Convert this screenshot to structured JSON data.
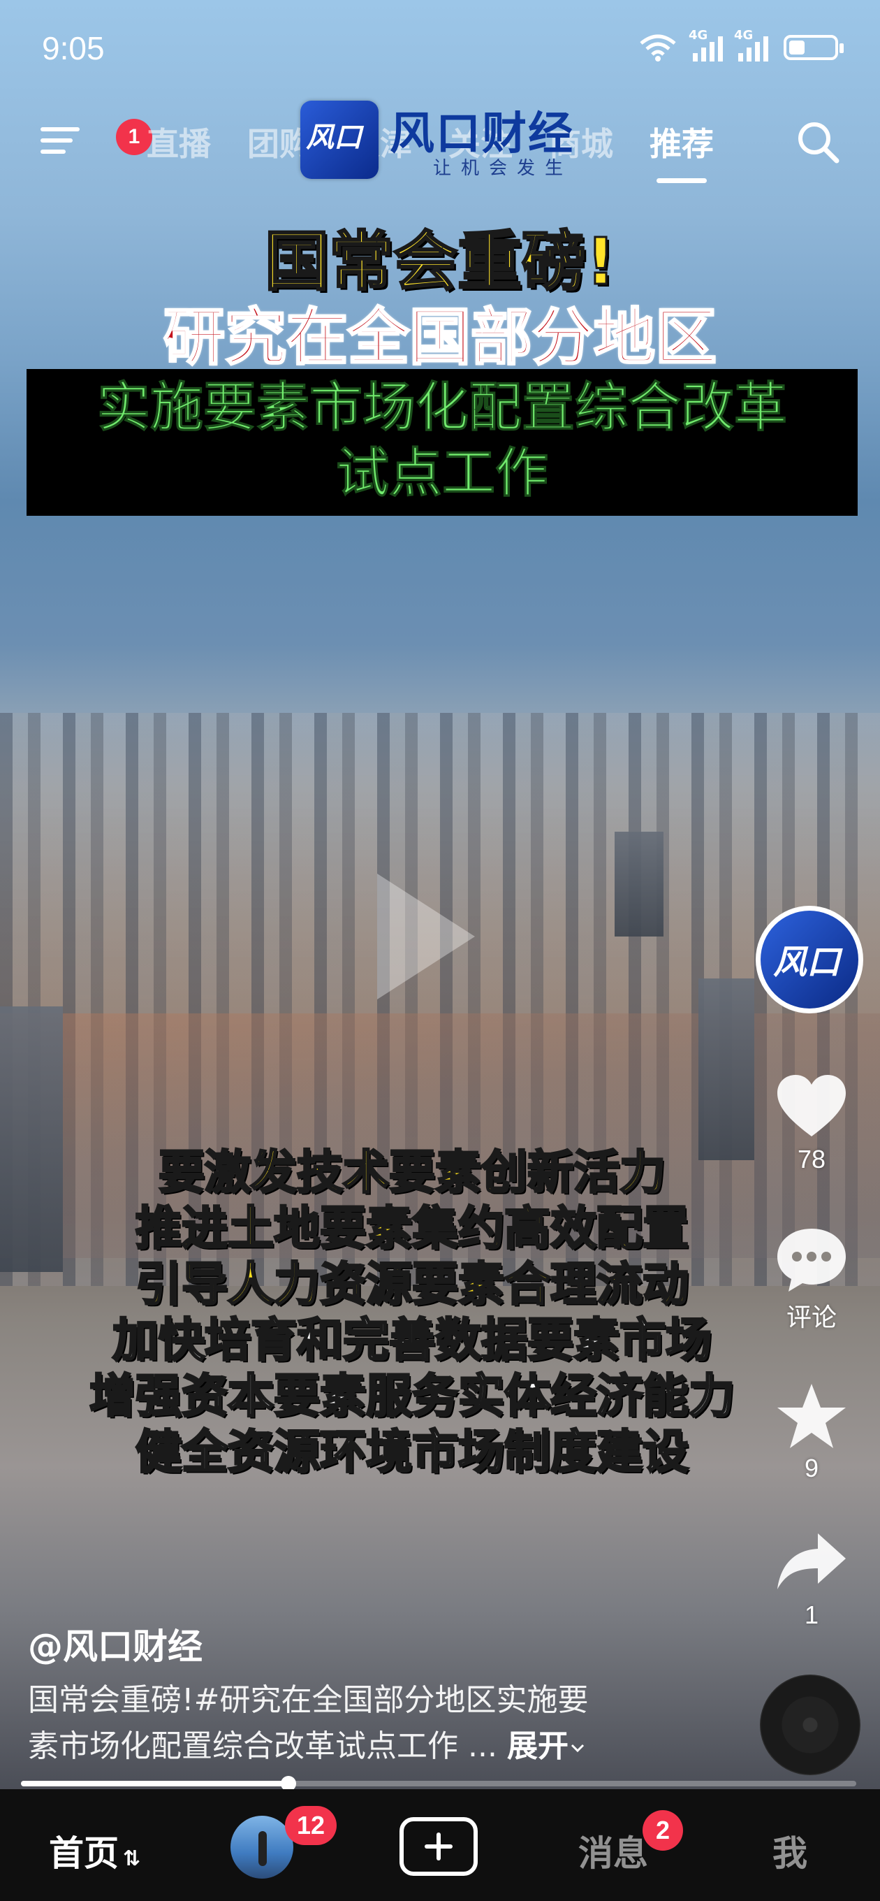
{
  "status_bar": {
    "time": "9:05",
    "signal_1_tag": "4G",
    "signal_2_tag": "4G",
    "battery_level": 0.35
  },
  "top_nav": {
    "menu_badge": "1",
    "tabs": [
      {
        "label": "直播",
        "active": false
      },
      {
        "label": "团购",
        "active": false
      },
      {
        "label": "天津",
        "active": false
      },
      {
        "label": "关注",
        "active": false
      },
      {
        "label": "商城",
        "active": false
      },
      {
        "label": "推荐",
        "active": true
      }
    ]
  },
  "watermark": {
    "box_text": "风口",
    "name": "风口财经",
    "slogan": "让机会发生"
  },
  "video_overlay": {
    "headline_1": "国常会重磅!",
    "headline_2": "研究在全国部分地区",
    "headline_3_line1": "实施要素市场化配置综合改革",
    "headline_3_line2": "试点工作",
    "subtitles": [
      "要激发技术要素创新活力",
      "推进土地要素集约高效配置",
      "引导人力资源要素合理流动",
      "加快培育和完善数据要素市场",
      "增强资本要素服务实体经济能力",
      "健全资源环境市场制度建设"
    ]
  },
  "right_rail": {
    "avatar_text": "风口",
    "like_count": "78",
    "comment_label": "评论",
    "favorite_count": "9",
    "share_count": "1"
  },
  "post": {
    "author": "@风口财经",
    "description_line1": "国常会重磅!#研究在全国部分地区实施要",
    "description_line2": "素市场化配置综合改革试点工作 ...",
    "expand_label": "展开"
  },
  "progress": {
    "fraction": 0.32
  },
  "bottom_bar": {
    "home_label": "首页",
    "friend_badge": "12",
    "messages_label": "消息",
    "messages_badge": "2",
    "me_label": "我"
  },
  "colors": {
    "badge": "#f2334b",
    "headline_yellow": "#ffe32a",
    "headline_red": "#c4141d",
    "headline_green": "#72ec6e",
    "brand_blue": "#0e3a9e"
  }
}
